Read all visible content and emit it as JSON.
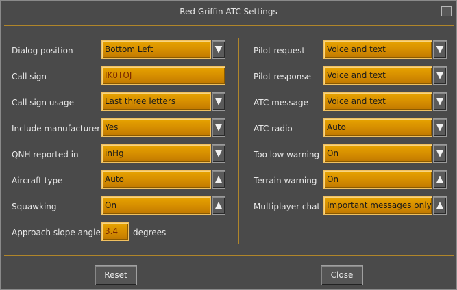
{
  "window": {
    "title": "Red Griffin ATC Settings"
  },
  "left": {
    "dialog_position": {
      "label": "Dialog position",
      "value": "Bottom Left"
    },
    "call_sign": {
      "label": "Call sign",
      "value": "IK0TOJ"
    },
    "call_sign_usage": {
      "label": "Call sign usage",
      "value": "Last three letters"
    },
    "include_manufacturer": {
      "label": "Include manufacturer",
      "value": "Yes"
    },
    "qnh_reported_in": {
      "label": "QNH reported in",
      "value": "inHg"
    },
    "aircraft_type": {
      "label": "Aircraft type",
      "value": "Auto"
    },
    "squawking": {
      "label": "Squawking",
      "value": "On"
    },
    "approach_slope_angle": {
      "label": "Approach slope angle",
      "value": "3.4",
      "unit": "degrees"
    }
  },
  "right": {
    "pilot_request": {
      "label": "Pilot request",
      "value": "Voice and text"
    },
    "pilot_response": {
      "label": "Pilot response",
      "value": "Voice and text"
    },
    "atc_message": {
      "label": "ATC message",
      "value": "Voice and text"
    },
    "atc_radio": {
      "label": "ATC radio",
      "value": "Auto"
    },
    "too_low_warning": {
      "label": "Too low warning",
      "value": "On"
    },
    "terrain_warning": {
      "label": "Terrain warning",
      "value": "On"
    },
    "multiplayer_chat": {
      "label": "Multiplayer chat",
      "value": "Important messages only"
    }
  },
  "icons": {
    "down": "▼",
    "up": "▲"
  },
  "buttons": {
    "reset": "Reset",
    "close": "Close"
  },
  "colors": {
    "field": "#d48c00",
    "separator": "#b0862a",
    "background": "#4a4a4a"
  }
}
